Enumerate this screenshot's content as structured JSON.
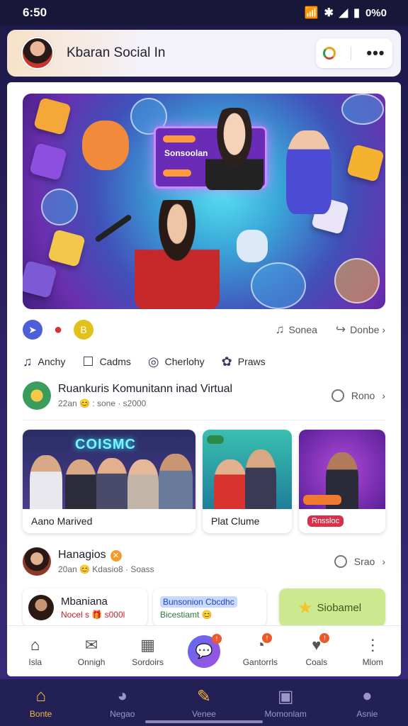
{
  "status_bar": {
    "time": "6:50",
    "battery": "0%0"
  },
  "header": {
    "title": "Kbaran Social In"
  },
  "banner": {
    "screen_label": "Sonsoolan"
  },
  "icon_row": {
    "right1": "Sonea",
    "right2": "Donbe"
  },
  "tabs": [
    {
      "label": "Anchy",
      "icon": "music-note-icon"
    },
    {
      "label": "Cadms",
      "icon": "box-icon"
    },
    {
      "label": "Cherlohy",
      "icon": "compass-icon"
    },
    {
      "label": "Praws",
      "icon": "globe-icon"
    }
  ],
  "post1": {
    "title": "Ruankuris Komunitann inad Virtual",
    "sub": "22an 😊 : sone · s2000",
    "action": "Rono"
  },
  "tiles": [
    {
      "caption": "Aano Marived",
      "neon": "COISMC"
    },
    {
      "caption": "Plat Clume"
    },
    {
      "caption": "Rnssloc",
      "badge": "Rnssloc"
    }
  ],
  "post2": {
    "title": "Hanagios",
    "sub": "20an 😊 Kdasio8 · Soass",
    "action": "Srao"
  },
  "chips": [
    {
      "name": "Mbaniana",
      "sub": "Nocel s 🎁 s000l"
    },
    {
      "name": "Bunsonion Cbcdhc",
      "sub": "Bicestiamt 😊"
    },
    {
      "name": "Siobamel"
    }
  ],
  "bottom_nav": [
    {
      "label": "Isla",
      "icon": "home-icon"
    },
    {
      "label": "Onnigh",
      "icon": "mail-icon"
    },
    {
      "label": "Sordoirs",
      "icon": "calendar-icon"
    },
    {
      "label": "",
      "icon": "chat-bubble-icon"
    },
    {
      "label": "Gantorrls",
      "icon": "user-search-icon"
    },
    {
      "label": "Coals",
      "icon": "heart-icon"
    },
    {
      "label": "Mlom",
      "icon": "more-vertical-icon"
    }
  ],
  "tab_bar": [
    {
      "label": "Bonte",
      "icon": "home-icon",
      "active": true
    },
    {
      "label": "Negao",
      "icon": "gamepad-icon"
    },
    {
      "label": "Venee",
      "icon": "edit-icon"
    },
    {
      "label": "Momonlam",
      "icon": "tv-icon"
    },
    {
      "label": "Asnie",
      "icon": "profile-icon"
    }
  ],
  "colors": {
    "accent": "#f6b53d",
    "brand_purple": "#5c3fc2",
    "badge_red": "#ec5a2a"
  }
}
